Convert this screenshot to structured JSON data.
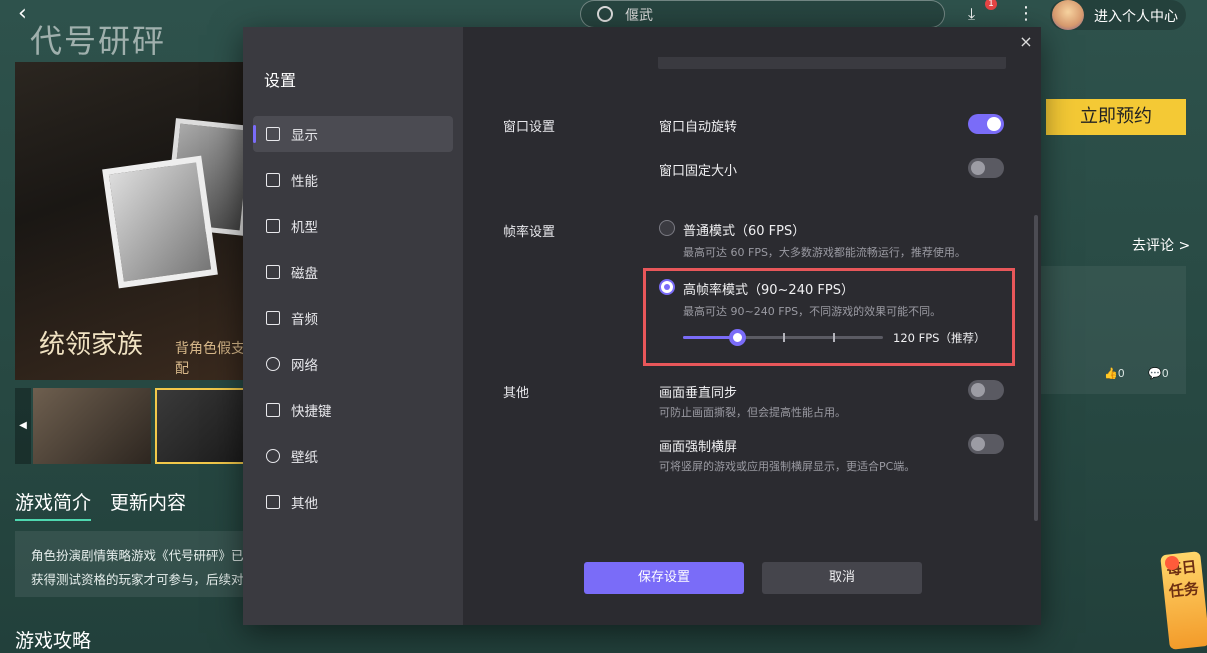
{
  "background": {
    "search_text": "偃武",
    "download_badge": "1",
    "user_center_label": "进入个人中心",
    "logo_text": "代号研砰",
    "banner_title": "统领家族",
    "banner_subtitle": "背角色假支配",
    "preorder_label": "立即预约",
    "comment_link": "去评论 >",
    "like_count": "0",
    "reply_count": "0",
    "tabs": [
      "游戏简介",
      "更新内容"
    ],
    "description_lines": [
      "角色扮演剧情策略游戏《代号研砰》已",
      "获得测试资格的玩家才可参与，后续对"
    ],
    "guide_title": "游戏攻略",
    "daily_task_label": "每日任务"
  },
  "settings": {
    "title": "设置",
    "close_icon": "×",
    "sidebar": [
      {
        "label": "显示",
        "icon": "monitor-icon",
        "active": true
      },
      {
        "label": "性能",
        "icon": "performance-icon"
      },
      {
        "label": "机型",
        "icon": "device-icon"
      },
      {
        "label": "磁盘",
        "icon": "disk-icon"
      },
      {
        "label": "音频",
        "icon": "gamepad-audio-icon"
      },
      {
        "label": "网络",
        "icon": "globe-icon"
      },
      {
        "label": "快捷键",
        "icon": "keyboard-icon"
      },
      {
        "label": "壁纸",
        "icon": "palette-icon"
      },
      {
        "label": "其他",
        "icon": "grid-icon"
      }
    ],
    "window_section": {
      "label": "窗口设置",
      "auto_rotate": {
        "label": "窗口自动旋转",
        "on": true
      },
      "fixed_size": {
        "label": "窗口固定大小",
        "on": false
      }
    },
    "frame_section": {
      "label": "帧率设置",
      "normal_mode": {
        "label": "普通模式（60 FPS）",
        "desc": "最高可达 60 FPS，大多数游戏都能流畅运行，推荐使用。",
        "selected": false
      },
      "high_mode": {
        "label": "高帧率模式（90~240 FPS）",
        "desc": "最高可达 90~240 FPS，不同游戏的效果可能不同。",
        "selected": true
      },
      "slider": {
        "value_label": "120 FPS（推荐）",
        "fraction": 0.27
      }
    },
    "other_section": {
      "label": "其他",
      "vsync": {
        "label": "画面垂直同步",
        "desc": "可防止画面撕裂，但会提高性能占用。",
        "on": false
      },
      "force_landscape": {
        "label": "画面强制横屏",
        "desc": "可将竖屏的游戏或应用强制横屏显示，更适合PC端。",
        "on": false
      }
    },
    "save_label": "保存设置",
    "cancel_label": "取消"
  }
}
